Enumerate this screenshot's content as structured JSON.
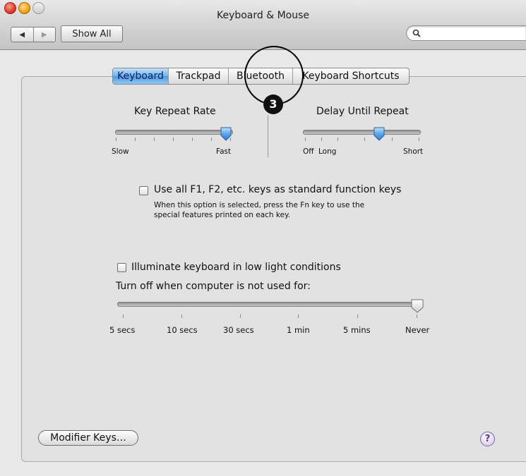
{
  "window": {
    "title": "Keyboard & Mouse",
    "show_all_label": "Show All",
    "back_glyph": "◀",
    "forward_glyph": "▶",
    "search": {
      "value": "",
      "placeholder": ""
    }
  },
  "tabs": [
    {
      "label": "Keyboard",
      "active": true
    },
    {
      "label": "Trackpad",
      "active": false
    },
    {
      "label": "Bluetooth",
      "active": false
    },
    {
      "label": "Keyboard Shortcuts",
      "active": false
    }
  ],
  "callout": {
    "number": "3"
  },
  "key_repeat": {
    "title": "Key Repeat Rate",
    "min_label": "Slow",
    "max_label": "Fast",
    "value_fraction": 1.0
  },
  "delay_repeat": {
    "title": "Delay Until Repeat",
    "off_label": "Off",
    "min_label": "Long",
    "max_label": "Short",
    "value_fraction": 0.65
  },
  "function_keys": {
    "label": "Use all F1, F2, etc. keys as standard function keys",
    "checked": false,
    "help_line1": "When this option is selected, press the Fn key to use the",
    "help_line2": "special features printed on each key."
  },
  "illuminate": {
    "label": "Illuminate keyboard in low light conditions",
    "checked": false
  },
  "turn_off": {
    "label": "Turn off when computer is not used for:",
    "ticks": [
      "5 secs",
      "10 secs",
      "30 secs",
      "1 min",
      "5 mins",
      "Never"
    ],
    "selected": "Never"
  },
  "buttons": {
    "modifier_keys": "Modifier Keys…",
    "help": "?"
  },
  "colors": {
    "accent": "#4c9be3",
    "help_purple": "#5a2ea6"
  }
}
